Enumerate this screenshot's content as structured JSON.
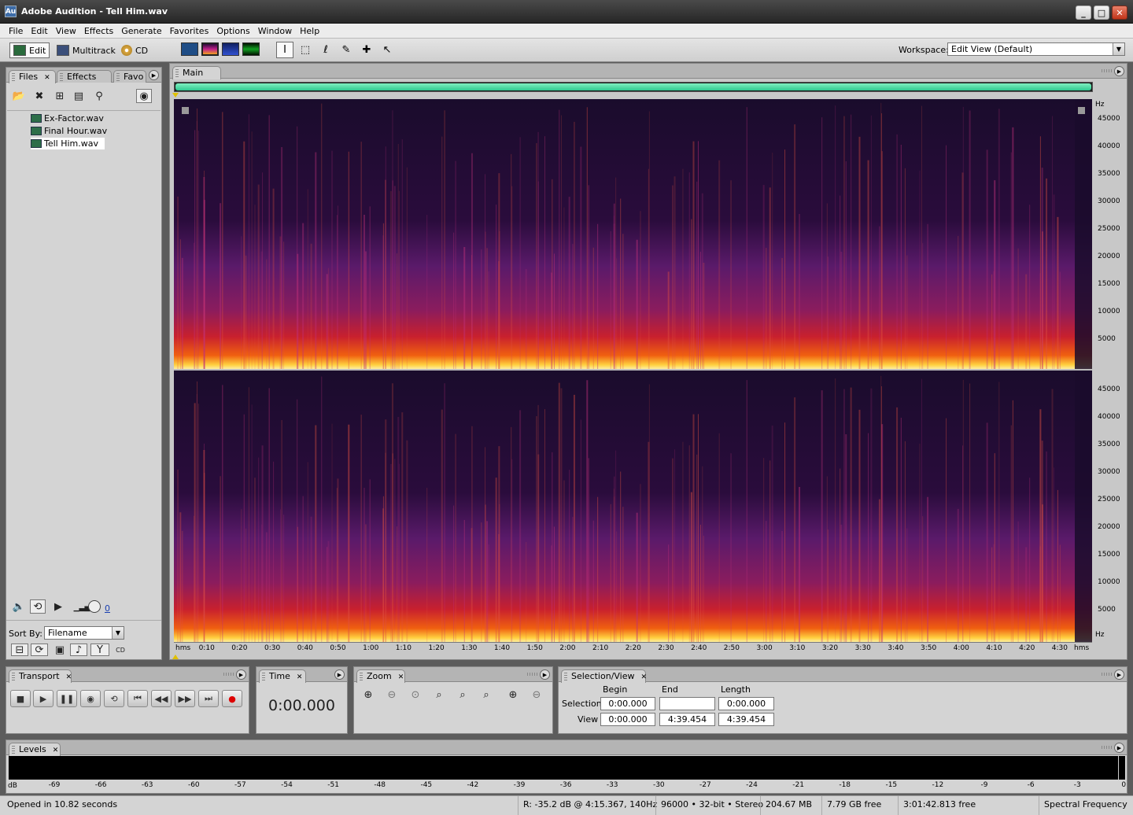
{
  "window": {
    "title": "Adobe Audition - Tell Him.wav",
    "icon": "Au"
  },
  "menu": [
    "File",
    "Edit",
    "View",
    "Effects",
    "Generate",
    "Favorites",
    "Options",
    "Window",
    "Help"
  ],
  "toolbar": {
    "edit": "Edit",
    "multitrack": "Multitrack",
    "cd": "CD",
    "workspace_label": "Workspace:",
    "workspace_value": "Edit View (Default)"
  },
  "files_panel": {
    "tabs": [
      "Files",
      "Effects",
      "Favo"
    ],
    "files": [
      "Ex-Factor.wav",
      "Final Hour.wav",
      "Tell Him.wav"
    ],
    "selected": 2,
    "sort_label": "Sort By:",
    "sort_value": "Filename",
    "volume_value": "0"
  },
  "main": {
    "tab": "Main",
    "freq_unit": "Hz",
    "freq_ticks": [
      "45000",
      "40000",
      "35000",
      "30000",
      "25000",
      "20000",
      "15000",
      "10000",
      "5000"
    ],
    "bottom_hz": "Hz",
    "time_unit": "hms",
    "time_ticks": [
      "0:10",
      "0:20",
      "0:30",
      "0:40",
      "0:50",
      "1:00",
      "1:10",
      "1:20",
      "1:30",
      "1:40",
      "1:50",
      "2:00",
      "2:10",
      "2:20",
      "2:30",
      "2:40",
      "2:50",
      "3:00",
      "3:10",
      "3:20",
      "3:30",
      "3:40",
      "3:50",
      "4:00",
      "4:10",
      "4:20",
      "4:30"
    ]
  },
  "transport": {
    "title": "Transport"
  },
  "time": {
    "title": "Time",
    "value": "0:00.000"
  },
  "zoom": {
    "title": "Zoom"
  },
  "selection": {
    "title": "Selection/View",
    "begin": "Begin",
    "end": "End",
    "length": "Length",
    "selection_label": "Selection",
    "view_label": "View",
    "sel_begin": "0:00.000",
    "sel_end": "",
    "sel_length": "0:00.000",
    "view_begin": "0:00.000",
    "view_end": "4:39.454",
    "view_length": "4:39.454"
  },
  "levels": {
    "title": "Levels",
    "unit": "dB",
    "ticks": [
      "-69",
      "-66",
      "-63",
      "-60",
      "-57",
      "-54",
      "-51",
      "-48",
      "-45",
      "-42",
      "-39",
      "-36",
      "-33",
      "-30",
      "-27",
      "-24",
      "-21",
      "-18",
      "-15",
      "-12",
      "-9",
      "-6",
      "-3",
      "0"
    ]
  },
  "status": {
    "opened": "Opened in 10.82 seconds",
    "cursor": "R: -35.2 dB @  4:15.367, 140Hz",
    "format": "96000 • 32-bit • Stereo",
    "size": "204.67 MB",
    "free": "7.79 GB free",
    "time_free": "3:01:42.813 free",
    "view_mode": "Spectral Frequency"
  }
}
